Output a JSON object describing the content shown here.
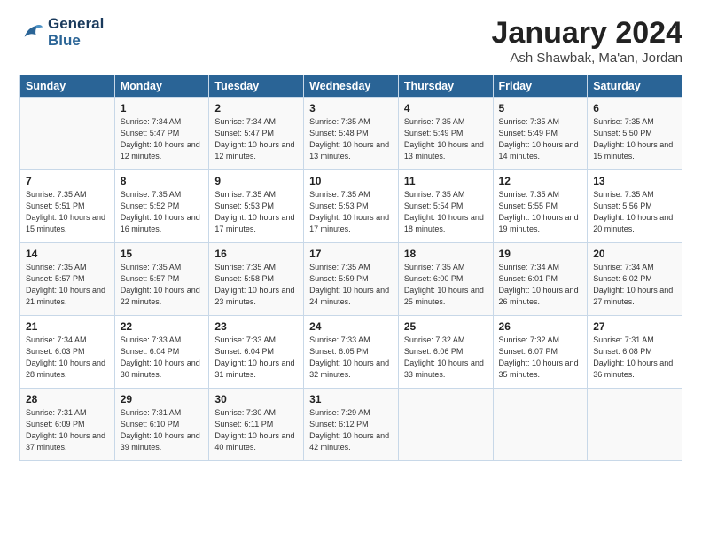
{
  "logo": {
    "line1": "General",
    "line2": "Blue"
  },
  "title": "January 2024",
  "location": "Ash Shawbak, Ma'an, Jordan",
  "days_of_week": [
    "Sunday",
    "Monday",
    "Tuesday",
    "Wednesday",
    "Thursday",
    "Friday",
    "Saturday"
  ],
  "weeks": [
    [
      {
        "day": "",
        "sunrise": "",
        "sunset": "",
        "daylight": ""
      },
      {
        "day": "1",
        "sunrise": "Sunrise: 7:34 AM",
        "sunset": "Sunset: 5:47 PM",
        "daylight": "Daylight: 10 hours and 12 minutes."
      },
      {
        "day": "2",
        "sunrise": "Sunrise: 7:34 AM",
        "sunset": "Sunset: 5:47 PM",
        "daylight": "Daylight: 10 hours and 12 minutes."
      },
      {
        "day": "3",
        "sunrise": "Sunrise: 7:35 AM",
        "sunset": "Sunset: 5:48 PM",
        "daylight": "Daylight: 10 hours and 13 minutes."
      },
      {
        "day": "4",
        "sunrise": "Sunrise: 7:35 AM",
        "sunset": "Sunset: 5:49 PM",
        "daylight": "Daylight: 10 hours and 13 minutes."
      },
      {
        "day": "5",
        "sunrise": "Sunrise: 7:35 AM",
        "sunset": "Sunset: 5:49 PM",
        "daylight": "Daylight: 10 hours and 14 minutes."
      },
      {
        "day": "6",
        "sunrise": "Sunrise: 7:35 AM",
        "sunset": "Sunset: 5:50 PM",
        "daylight": "Daylight: 10 hours and 15 minutes."
      }
    ],
    [
      {
        "day": "7",
        "sunrise": "Sunrise: 7:35 AM",
        "sunset": "Sunset: 5:51 PM",
        "daylight": "Daylight: 10 hours and 15 minutes."
      },
      {
        "day": "8",
        "sunrise": "Sunrise: 7:35 AM",
        "sunset": "Sunset: 5:52 PM",
        "daylight": "Daylight: 10 hours and 16 minutes."
      },
      {
        "day": "9",
        "sunrise": "Sunrise: 7:35 AM",
        "sunset": "Sunset: 5:53 PM",
        "daylight": "Daylight: 10 hours and 17 minutes."
      },
      {
        "day": "10",
        "sunrise": "Sunrise: 7:35 AM",
        "sunset": "Sunset: 5:53 PM",
        "daylight": "Daylight: 10 hours and 17 minutes."
      },
      {
        "day": "11",
        "sunrise": "Sunrise: 7:35 AM",
        "sunset": "Sunset: 5:54 PM",
        "daylight": "Daylight: 10 hours and 18 minutes."
      },
      {
        "day": "12",
        "sunrise": "Sunrise: 7:35 AM",
        "sunset": "Sunset: 5:55 PM",
        "daylight": "Daylight: 10 hours and 19 minutes."
      },
      {
        "day": "13",
        "sunrise": "Sunrise: 7:35 AM",
        "sunset": "Sunset: 5:56 PM",
        "daylight": "Daylight: 10 hours and 20 minutes."
      }
    ],
    [
      {
        "day": "14",
        "sunrise": "Sunrise: 7:35 AM",
        "sunset": "Sunset: 5:57 PM",
        "daylight": "Daylight: 10 hours and 21 minutes."
      },
      {
        "day": "15",
        "sunrise": "Sunrise: 7:35 AM",
        "sunset": "Sunset: 5:57 PM",
        "daylight": "Daylight: 10 hours and 22 minutes."
      },
      {
        "day": "16",
        "sunrise": "Sunrise: 7:35 AM",
        "sunset": "Sunset: 5:58 PM",
        "daylight": "Daylight: 10 hours and 23 minutes."
      },
      {
        "day": "17",
        "sunrise": "Sunrise: 7:35 AM",
        "sunset": "Sunset: 5:59 PM",
        "daylight": "Daylight: 10 hours and 24 minutes."
      },
      {
        "day": "18",
        "sunrise": "Sunrise: 7:35 AM",
        "sunset": "Sunset: 6:00 PM",
        "daylight": "Daylight: 10 hours and 25 minutes."
      },
      {
        "day": "19",
        "sunrise": "Sunrise: 7:34 AM",
        "sunset": "Sunset: 6:01 PM",
        "daylight": "Daylight: 10 hours and 26 minutes."
      },
      {
        "day": "20",
        "sunrise": "Sunrise: 7:34 AM",
        "sunset": "Sunset: 6:02 PM",
        "daylight": "Daylight: 10 hours and 27 minutes."
      }
    ],
    [
      {
        "day": "21",
        "sunrise": "Sunrise: 7:34 AM",
        "sunset": "Sunset: 6:03 PM",
        "daylight": "Daylight: 10 hours and 28 minutes."
      },
      {
        "day": "22",
        "sunrise": "Sunrise: 7:33 AM",
        "sunset": "Sunset: 6:04 PM",
        "daylight": "Daylight: 10 hours and 30 minutes."
      },
      {
        "day": "23",
        "sunrise": "Sunrise: 7:33 AM",
        "sunset": "Sunset: 6:04 PM",
        "daylight": "Daylight: 10 hours and 31 minutes."
      },
      {
        "day": "24",
        "sunrise": "Sunrise: 7:33 AM",
        "sunset": "Sunset: 6:05 PM",
        "daylight": "Daylight: 10 hours and 32 minutes."
      },
      {
        "day": "25",
        "sunrise": "Sunrise: 7:32 AM",
        "sunset": "Sunset: 6:06 PM",
        "daylight": "Daylight: 10 hours and 33 minutes."
      },
      {
        "day": "26",
        "sunrise": "Sunrise: 7:32 AM",
        "sunset": "Sunset: 6:07 PM",
        "daylight": "Daylight: 10 hours and 35 minutes."
      },
      {
        "day": "27",
        "sunrise": "Sunrise: 7:31 AM",
        "sunset": "Sunset: 6:08 PM",
        "daylight": "Daylight: 10 hours and 36 minutes."
      }
    ],
    [
      {
        "day": "28",
        "sunrise": "Sunrise: 7:31 AM",
        "sunset": "Sunset: 6:09 PM",
        "daylight": "Daylight: 10 hours and 37 minutes."
      },
      {
        "day": "29",
        "sunrise": "Sunrise: 7:31 AM",
        "sunset": "Sunset: 6:10 PM",
        "daylight": "Daylight: 10 hours and 39 minutes."
      },
      {
        "day": "30",
        "sunrise": "Sunrise: 7:30 AM",
        "sunset": "Sunset: 6:11 PM",
        "daylight": "Daylight: 10 hours and 40 minutes."
      },
      {
        "day": "31",
        "sunrise": "Sunrise: 7:29 AM",
        "sunset": "Sunset: 6:12 PM",
        "daylight": "Daylight: 10 hours and 42 minutes."
      },
      {
        "day": "",
        "sunrise": "",
        "sunset": "",
        "daylight": ""
      },
      {
        "day": "",
        "sunrise": "",
        "sunset": "",
        "daylight": ""
      },
      {
        "day": "",
        "sunrise": "",
        "sunset": "",
        "daylight": ""
      }
    ]
  ]
}
